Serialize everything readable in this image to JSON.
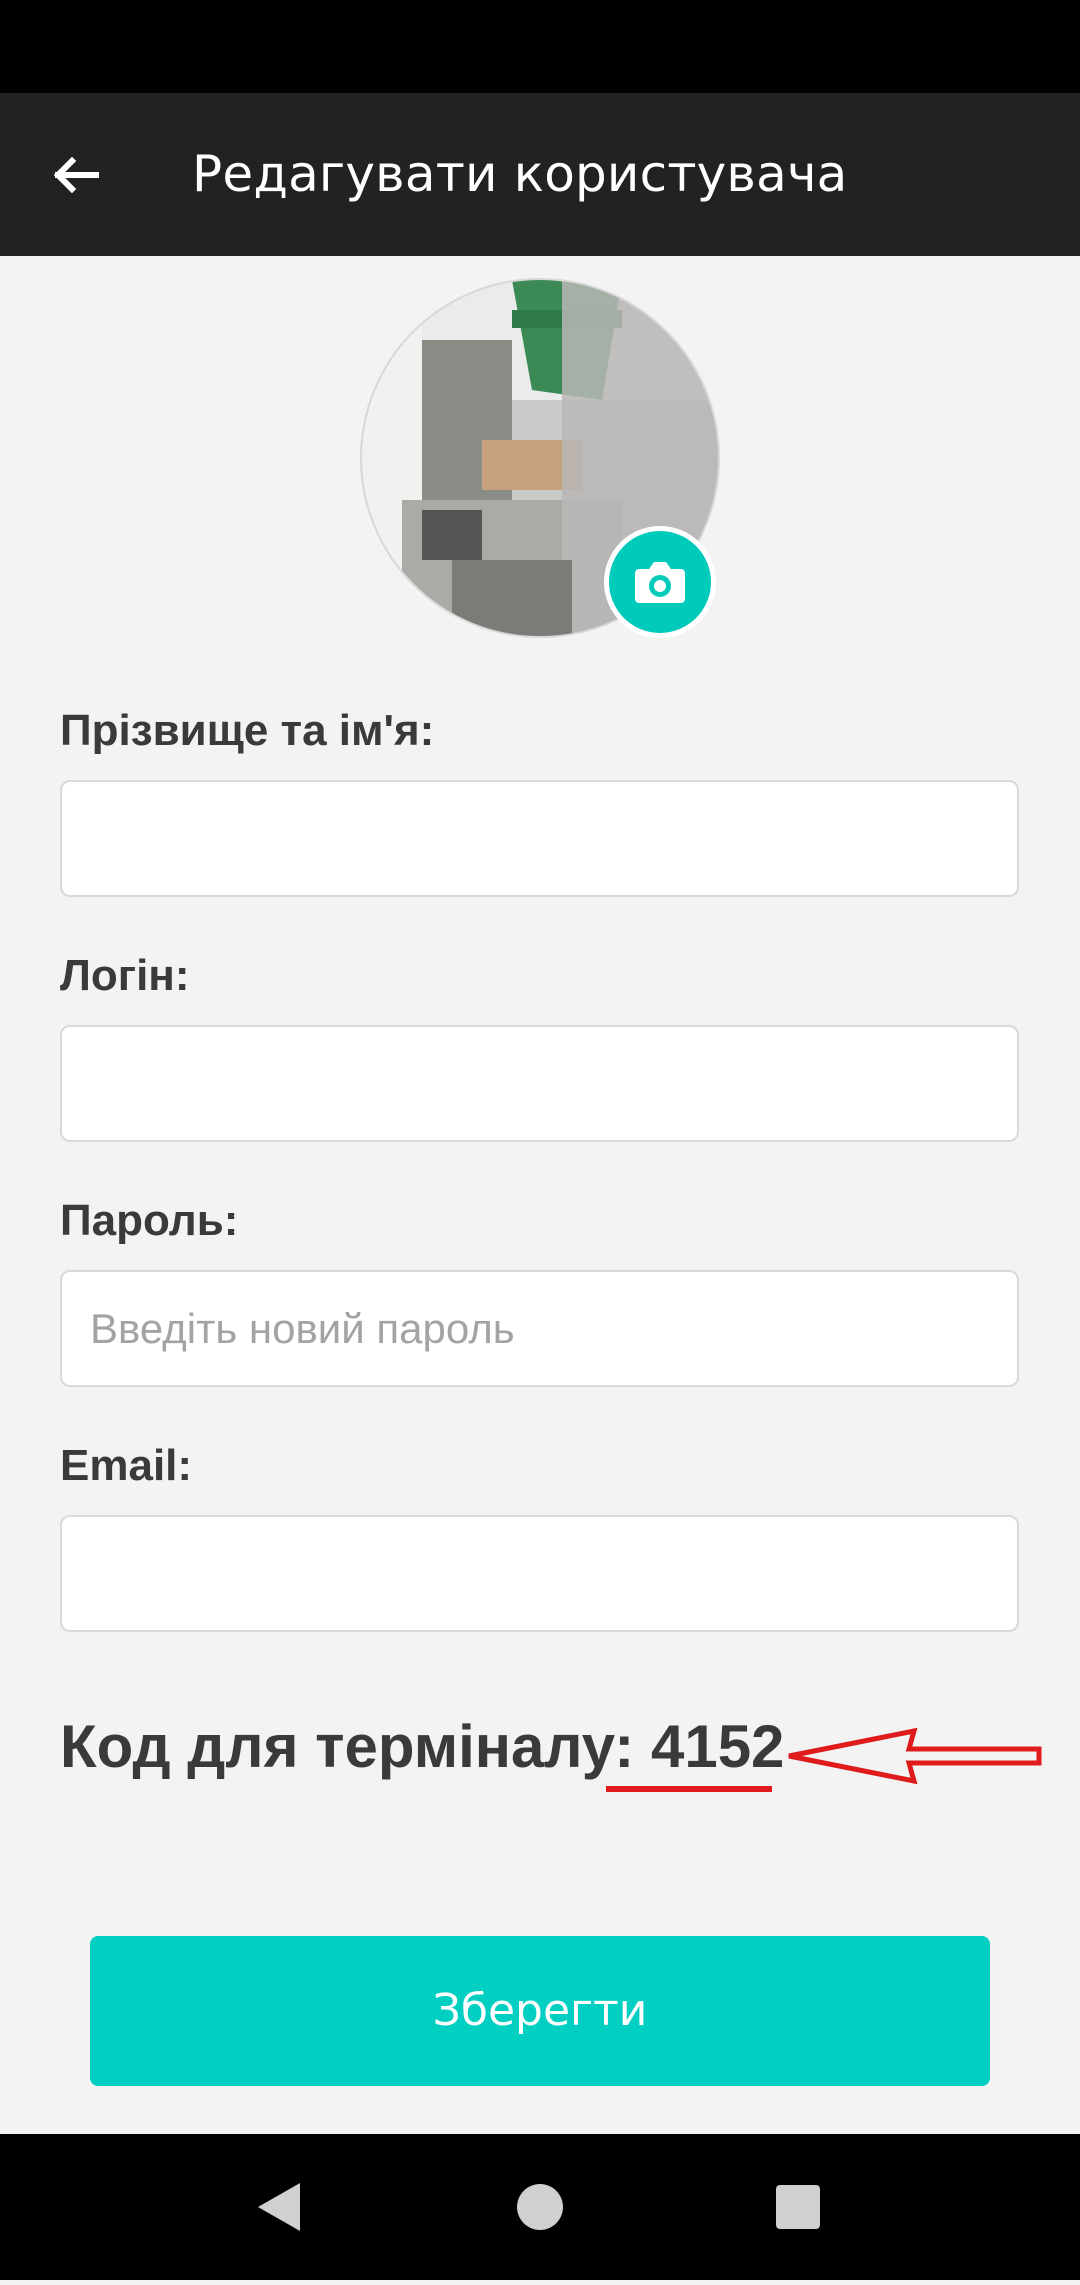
{
  "app_bar": {
    "title": "Редагувати користувача",
    "back_icon": "arrow-left-icon"
  },
  "avatar": {
    "camera_icon": "camera-icon",
    "accent_color": "#00cbbb"
  },
  "form": {
    "fields": [
      {
        "label": "Прізвище та ім'я:",
        "value": "",
        "placeholder": ""
      },
      {
        "label": "Логін:",
        "value": "",
        "placeholder": ""
      },
      {
        "label": "Пароль:",
        "value": "",
        "placeholder": "Введіть новий пароль"
      },
      {
        "label": "Email:",
        "value": "",
        "placeholder": ""
      }
    ]
  },
  "terminal": {
    "label": "Код для терміналу:",
    "code": "4152",
    "annotation_color": "#e01b1b"
  },
  "actions": {
    "save_label": "Зберегти",
    "save_color": "#00cfc1"
  },
  "system_nav": {
    "back_icon": "nav-back-icon",
    "home_icon": "nav-home-icon",
    "recents_icon": "nav-recents-icon"
  }
}
